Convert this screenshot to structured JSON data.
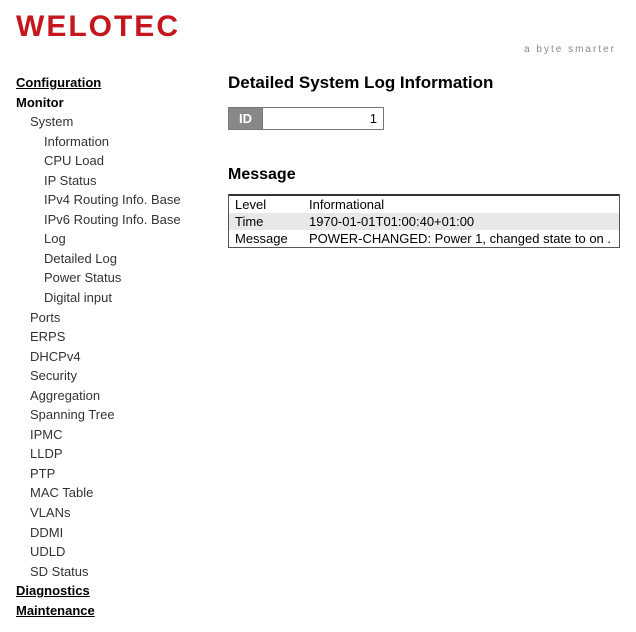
{
  "logo": {
    "name": "WELOTEC",
    "tagline": "a byte smarter"
  },
  "nav": {
    "configuration": "Configuration",
    "monitor": "Monitor",
    "system": "System",
    "system_children": {
      "information": "Information",
      "cpu_load": "CPU Load",
      "ip_status": "IP Status",
      "ipv4_routing": "IPv4 Routing Info. Base",
      "ipv6_routing": "IPv6 Routing Info. Base",
      "log": "Log",
      "detailed_log": "Detailed Log",
      "power_status": "Power Status",
      "digital_input": "Digital input"
    },
    "monitor_children": {
      "ports": "Ports",
      "erps": "ERPS",
      "dhcpv4": "DHCPv4",
      "security": "Security",
      "aggregation": "Aggregation",
      "spanning_tree": "Spanning Tree",
      "ipmc": "IPMC",
      "lldp": "LLDP",
      "ptp": "PTP",
      "mac_table": "MAC Table",
      "vlans": "VLANs",
      "ddmi": "DDMI",
      "udld": "UDLD",
      "sd_status": "SD Status"
    },
    "diagnostics": "Diagnostics",
    "maintenance": "Maintenance"
  },
  "main": {
    "title": "Detailed System Log Information",
    "id_label": "ID",
    "id_value": "1",
    "message_title": "Message",
    "rows": {
      "level": {
        "key": "Level",
        "val": "Informational"
      },
      "time": {
        "key": "Time",
        "val": "1970-01-01T01:00:40+01:00"
      },
      "message": {
        "key": "Message",
        "val": "POWER-CHANGED: Power 1, changed state to on ."
      }
    }
  }
}
